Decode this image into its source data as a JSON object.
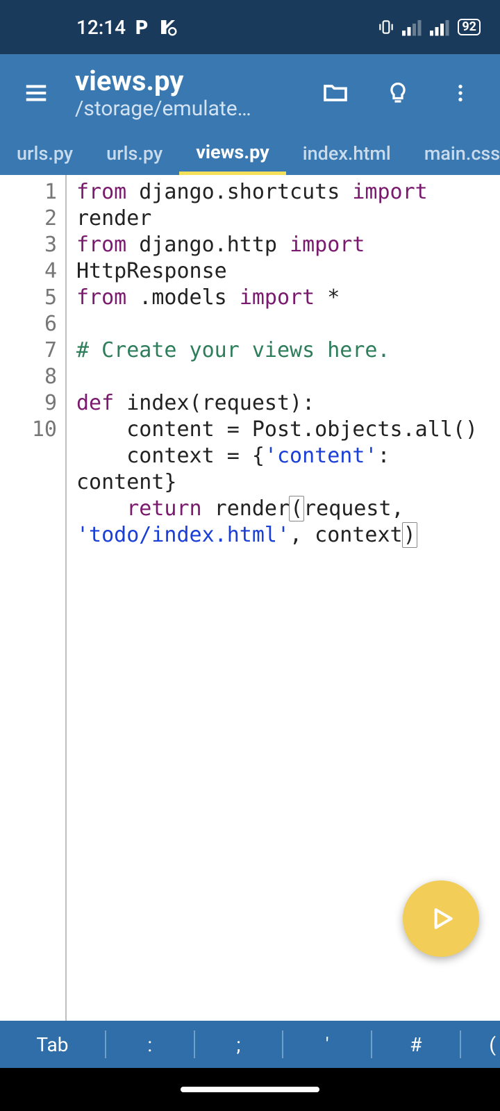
{
  "status": {
    "time": "12:14",
    "battery": "92"
  },
  "appbar": {
    "title": "views.py",
    "subtitle": "/storage/emulate…"
  },
  "tabs": [
    {
      "label": "urls.py",
      "active": false
    },
    {
      "label": "urls.py",
      "active": false
    },
    {
      "label": "views.py",
      "active": true
    },
    {
      "label": "index.html",
      "active": false
    },
    {
      "label": "main.css",
      "active": false
    }
  ],
  "line_numbers": [
    "1",
    "2",
    "3",
    "4",
    "5",
    "6",
    "7",
    "8",
    "9",
    "10"
  ],
  "code": {
    "l1_from": "from",
    "l1_mod": " django.shortcuts ",
    "l1_import": "import",
    "l1_rest": " render",
    "l2_from": "from",
    "l2_mod": " django.http ",
    "l2_import": "import",
    "l2_rest": " HttpResponse",
    "l3_from": "from",
    "l3_mod": " .models ",
    "l3_import": "import",
    "l3_rest": " *",
    "l5_comment": "# Create your views here.",
    "l7_def": "def",
    "l7_rest": " index(request):",
    "l8": "    content = Post.objects.all()",
    "l9_a": "    context = {",
    "l9_str": "'content'",
    "l9_b": ": content}",
    "l10_ret": "    return",
    "l10_a": " render",
    "l10_lp": "(",
    "l10_b": "request, ",
    "l10_str": "'todo/index.html'",
    "l10_c": ", context",
    "l10_rp": ")"
  },
  "keyrow": {
    "k0": "Tab",
    "k1": ":",
    "k2": ";",
    "k3": "'",
    "k4": "#",
    "k5": "("
  }
}
